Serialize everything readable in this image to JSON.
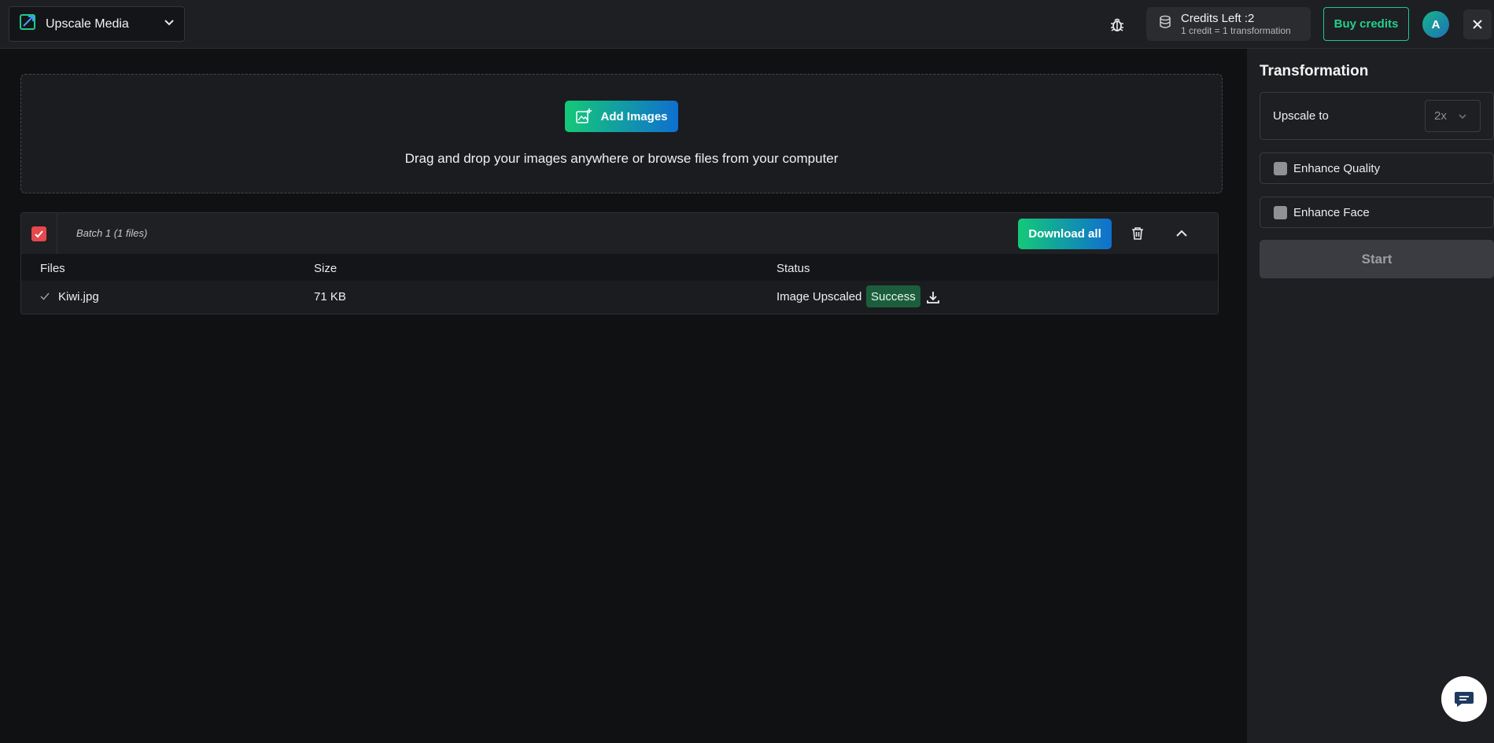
{
  "header": {
    "app_selector": {
      "label": "Upscale Media",
      "icon": "upscale-logo-icon",
      "chevron": "chevron-down-icon"
    },
    "bug_icon": "bug-icon",
    "credits": {
      "title": "Credits Left :2",
      "subtitle": "1 credit = 1 transformation",
      "icon": "database-icon"
    },
    "buy_label": "Buy credits",
    "avatar_initial": "A",
    "close_icon": "close-icon"
  },
  "dropzone": {
    "add_images_label": "Add Images",
    "hint": "Drag and drop your images anywhere or browse files from your computer"
  },
  "batch": {
    "title": "Batch 1 (1 files)",
    "download_all_label": "Download all",
    "columns": {
      "files": "Files",
      "size": "Size",
      "status": "Status"
    },
    "rows": [
      {
        "file": "Kiwi.jpg",
        "size": "71 KB",
        "status_text": "Image Upscaled",
        "badge": "Success"
      }
    ]
  },
  "sidebar": {
    "title": "Transformation",
    "upscale_label": "Upscale to",
    "upscale_value": "2x",
    "options": [
      {
        "label": "Enhance Quality",
        "checked": false
      },
      {
        "label": "Enhance Face",
        "checked": false
      }
    ],
    "start_label": "Start"
  },
  "colors": {
    "accent_green": "#22d08f",
    "gradient_start": "#14c978",
    "gradient_end": "#0f6fd0",
    "success_badge": "#1c5e3c",
    "checkbox_red": "#e5484d"
  }
}
